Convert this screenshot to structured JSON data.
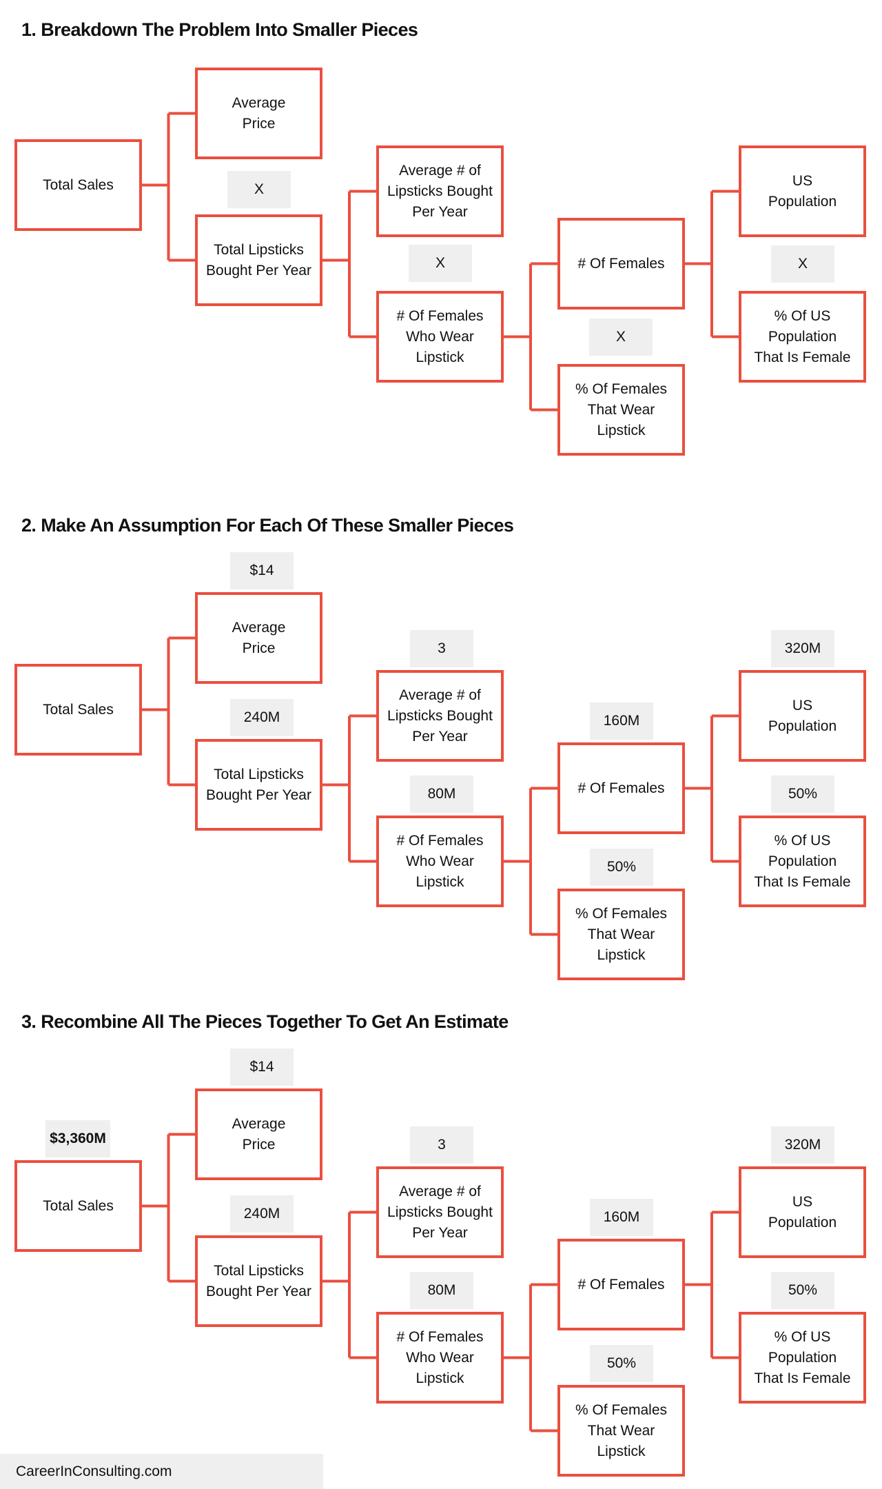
{
  "colors": {
    "box_border": "#ea4f3f",
    "chip_bg": "#efefef",
    "text": "#111111"
  },
  "nodes": {
    "total": "Total Sales",
    "price": "Average\nPrice",
    "lipsticks": "Total Lipsticks\nBought Per Year",
    "avg": "Average # of\nLipsticks Bought\nPer Year",
    "fwl": "# Of Females\nWho Wear\nLipstick",
    "females": "# Of Females",
    "pct_f": "% Of Females\nThat Wear\nLipstick",
    "us": "US\nPopulation",
    "pct_us": "% Of US\nPopulation\nThat Is Female"
  },
  "operator": "X",
  "sections": [
    {
      "title": "1. Breakdown The Problem Into Smaller Pieces"
    },
    {
      "title": "2. Make An Assumption For Each Of These Smaller Pieces"
    },
    {
      "title": "3. Recombine All The Pieces Together To Get An Estimate"
    }
  ],
  "values": {
    "total": "$3,360M",
    "price": "$14",
    "lipsticks": "240M",
    "avg": "3",
    "fwl": "80M",
    "females": "160M",
    "pct_f": "50%",
    "us": "320M",
    "pct_us": "50%"
  },
  "footer": "CareerInConsulting.com"
}
